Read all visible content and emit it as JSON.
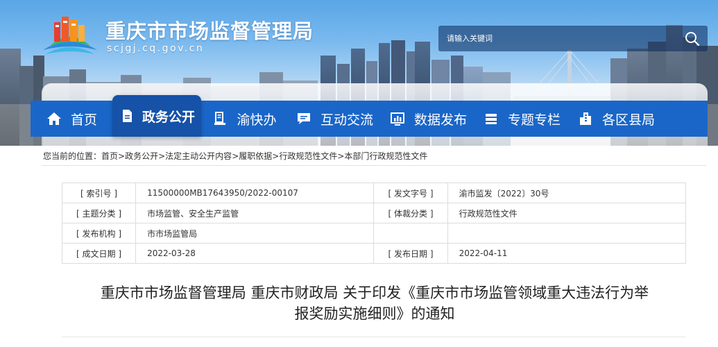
{
  "header": {
    "site_title": "重庆市市场监督管理局",
    "site_domain": "scjgj.cq.gov.cn",
    "logo_icon": "city-emblem-icon",
    "search": {
      "placeholder": "请输入关键词",
      "icon": "search-icon"
    }
  },
  "nav": {
    "items": [
      {
        "label": "首页",
        "icon": "home-icon",
        "active": false
      },
      {
        "label": "政务公开",
        "icon": "document-icon",
        "active": true
      },
      {
        "label": "渝快办",
        "icon": "service-icon",
        "active": false
      },
      {
        "label": "互动交流",
        "icon": "chat-icon",
        "active": false
      },
      {
        "label": "数据发布",
        "icon": "chart-icon",
        "active": false
      },
      {
        "label": "专题专栏",
        "icon": "stack-icon",
        "active": false
      },
      {
        "label": "各区县局",
        "icon": "building-icon",
        "active": false
      }
    ]
  },
  "breadcrumb": {
    "prefix": "您当前的位置：",
    "items": [
      "首页",
      "政务公开",
      "法定主动公开内容",
      "履职依据",
      "行政规范性文件",
      "本部门行政规范性文件"
    ],
    "separator": ">"
  },
  "meta": {
    "index_label": "[ 索引号 ]",
    "index_value": "11500000MB17643950/2022-00107",
    "doc_no_label": "[ 发文字号 ]",
    "doc_no_value": "渝市监发〔2022〕30号",
    "topic_label": "[ 主题分类 ]",
    "topic_value": "市场监管、安全生产监管",
    "genre_label": "[ 体裁分类 ]",
    "genre_value": "行政规范性文件",
    "issuer_label": "[ 发布机构 ]",
    "issuer_value": "市市场监管局",
    "created_label": "[ 成文日期 ]",
    "created_value": "2022-03-28",
    "published_label": "[ 发布日期 ]",
    "published_value": "2022-04-11"
  },
  "document": {
    "title_line1": "重庆市市场监督管理局 重庆市财政局 关于印发《重庆市市场监管领域重大违法行为举",
    "title_line2": "报奖励实施细则》的通知"
  },
  "colors": {
    "nav_blue": "#1a66c8",
    "nav_active": "#1552a8"
  }
}
